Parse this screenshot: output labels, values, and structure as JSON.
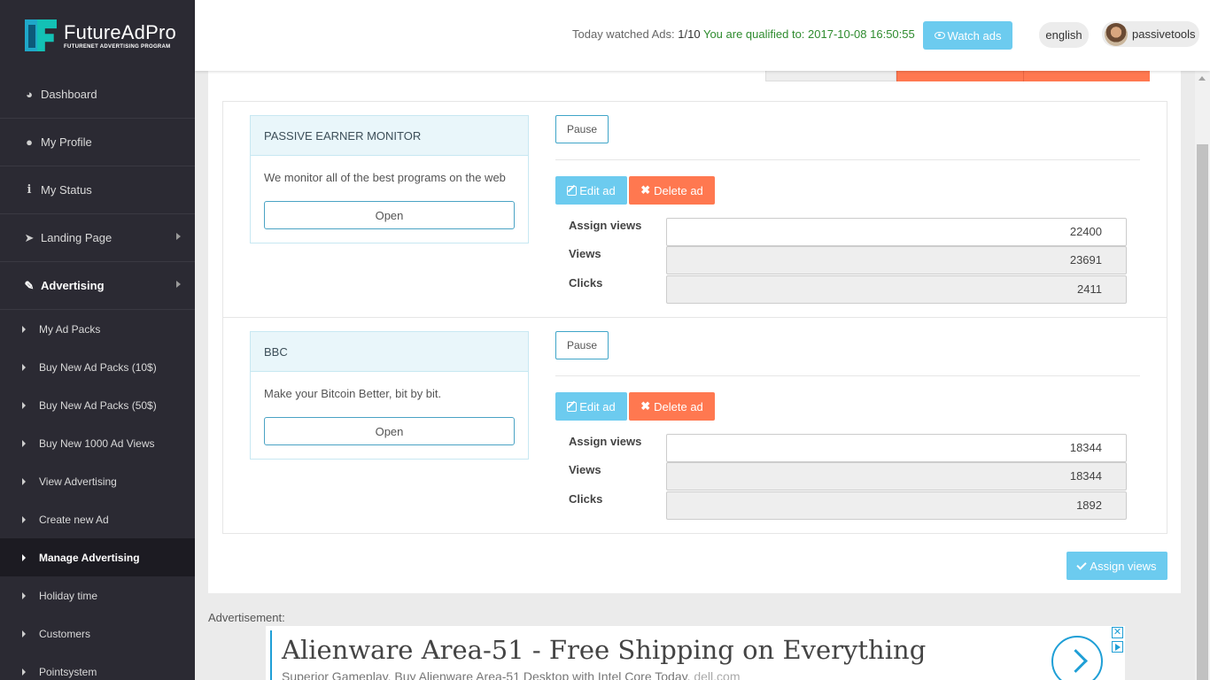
{
  "brand": {
    "name": "FutureAdPro",
    "tagline": "FUTURENET ADVERTISING PROGRAM"
  },
  "sidebar": {
    "items": [
      {
        "label": "Dashboard",
        "icon": "dashboard-icon"
      },
      {
        "label": "My Profile",
        "icon": "user-icon"
      },
      {
        "label": "My Status",
        "icon": "info-icon"
      },
      {
        "label": "Landing Page",
        "icon": "paper-plane-icon"
      },
      {
        "label": "Advertising",
        "icon": "magic-wand-icon"
      }
    ],
    "subitems": [
      {
        "label": "My Ad Packs"
      },
      {
        "label": "Buy New Ad Packs (10$)"
      },
      {
        "label": "Buy New Ad Packs (50$)"
      },
      {
        "label": "Buy New 1000 Ad Views"
      },
      {
        "label": "View Advertising"
      },
      {
        "label": "Create new Ad"
      },
      {
        "label": "Manage Advertising"
      },
      {
        "label": "Holiday time"
      },
      {
        "label": "Customers"
      },
      {
        "label": "Pointsystem"
      }
    ]
  },
  "header": {
    "today_label": "Today watched Ads:",
    "today_count": "1/10",
    "qualified_text": "You are qualified to: 2017-10-08 16:50:55",
    "watch_button": "Watch ads",
    "language": "english",
    "username": "passivetools"
  },
  "ads": [
    {
      "title": "PASSIVE EARNER MONITOR",
      "description": "We monitor all of the best programs on the web",
      "open_label": "Open",
      "pause_label": "Pause",
      "edit_label": "Edit ad",
      "delete_label": "Delete ad",
      "assign_views_label": "Assign views",
      "assign_views": "22400",
      "views_label": "Views",
      "views": "23691",
      "clicks_label": "Clicks",
      "clicks": "2411"
    },
    {
      "title": "BBC",
      "description": "Make your Bitcoin Better, bit by bit.",
      "open_label": "Open",
      "pause_label": "Pause",
      "edit_label": "Edit ad",
      "delete_label": "Delete ad",
      "assign_views_label": "Assign views",
      "assign_views": "18344",
      "views_label": "Views",
      "views": "18344",
      "clicks_label": "Clicks",
      "clicks": "1892"
    }
  ],
  "assign_button": "Assign views",
  "advertisement": {
    "label": "Advertisement:",
    "title": "Alienware Area-51 - Free Shipping on Everything",
    "subtitle": "Superior Gameplay. Buy Alienware Area-51 Desktop with Intel Core Today.",
    "domain": "dell.com"
  },
  "colors": {
    "sidebar_bg": "#2b2a33",
    "accent_blue": "#6ccbef",
    "accent_orange": "#ff7850",
    "qualified_green": "#2e8b2e"
  }
}
